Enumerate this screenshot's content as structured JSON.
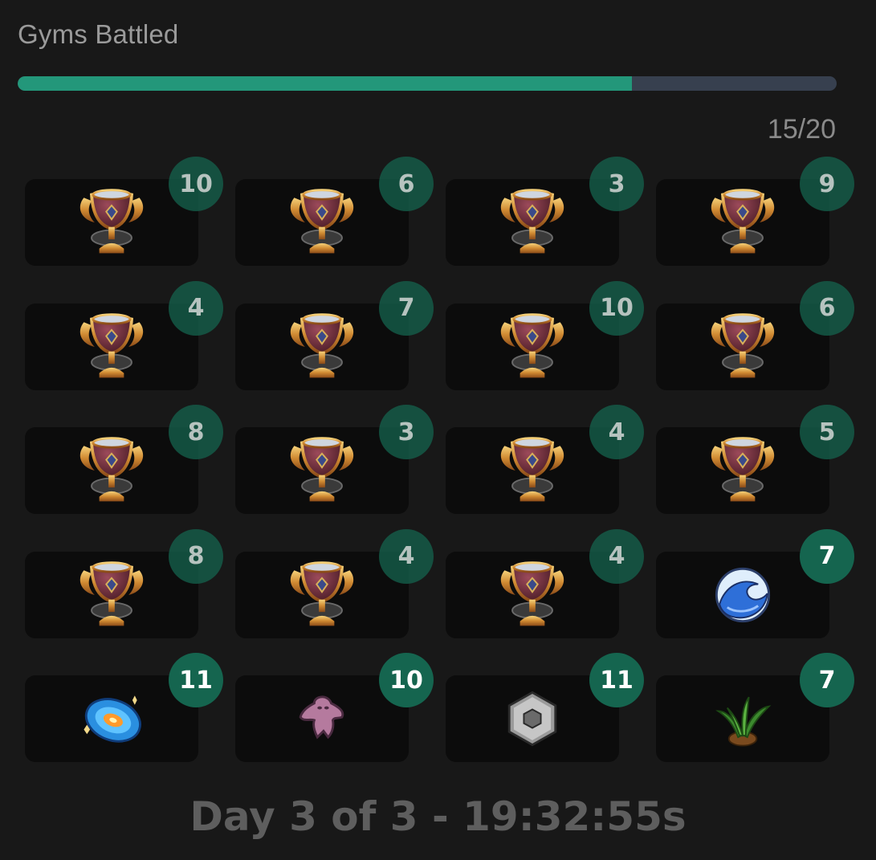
{
  "title": "Gyms Battled",
  "progress": {
    "value": 15,
    "max": 20,
    "label": "15/20",
    "fill_color": "#23977a",
    "track_color": "#37404f"
  },
  "gyms": [
    {
      "count": "10",
      "icon": "trophy-icon",
      "state": "dim"
    },
    {
      "count": "6",
      "icon": "trophy-icon",
      "state": "dim"
    },
    {
      "count": "3",
      "icon": "trophy-icon",
      "state": "dim"
    },
    {
      "count": "9",
      "icon": "trophy-icon",
      "state": "dim"
    },
    {
      "count": "4",
      "icon": "trophy-icon",
      "state": "dim"
    },
    {
      "count": "7",
      "icon": "trophy-icon",
      "state": "dim"
    },
    {
      "count": "10",
      "icon": "trophy-icon",
      "state": "dim"
    },
    {
      "count": "6",
      "icon": "trophy-icon",
      "state": "dim"
    },
    {
      "count": "8",
      "icon": "trophy-icon",
      "state": "dim"
    },
    {
      "count": "3",
      "icon": "trophy-icon",
      "state": "dim"
    },
    {
      "count": "4",
      "icon": "trophy-icon",
      "state": "dim"
    },
    {
      "count": "5",
      "icon": "trophy-icon",
      "state": "dim"
    },
    {
      "count": "8",
      "icon": "trophy-icon",
      "state": "dim"
    },
    {
      "count": "4",
      "icon": "trophy-icon",
      "state": "dim"
    },
    {
      "count": "4",
      "icon": "trophy-icon",
      "state": "dim"
    },
    {
      "count": "7",
      "icon": "water-wave-icon",
      "state": "bright"
    },
    {
      "count": "11",
      "icon": "psychic-vortex-icon",
      "state": "bright"
    },
    {
      "count": "10",
      "icon": "ghost-icon",
      "state": "bright"
    },
    {
      "count": "11",
      "icon": "steel-hexnut-icon",
      "state": "bright"
    },
    {
      "count": "7",
      "icon": "grass-sprout-icon",
      "state": "bright"
    }
  ],
  "footer": "Day 3 of 3 - 19:32:55s"
}
